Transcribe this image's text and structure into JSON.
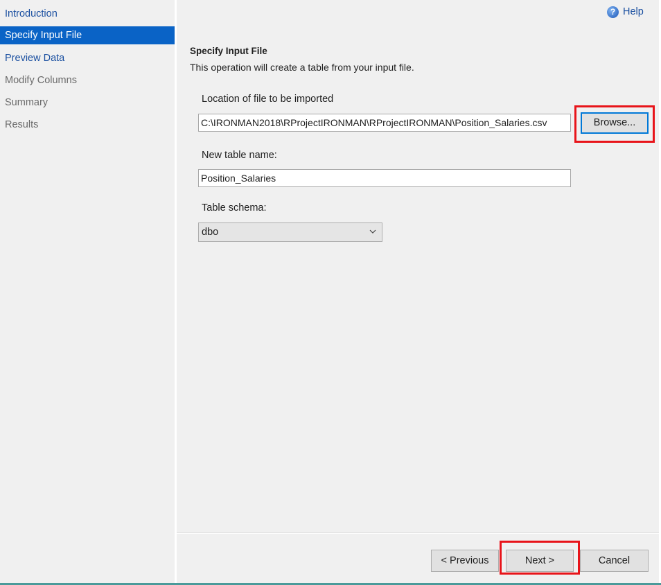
{
  "sidebar": {
    "items": [
      {
        "label": "Introduction",
        "state": "link"
      },
      {
        "label": "Specify Input File",
        "state": "active"
      },
      {
        "label": "Preview Data",
        "state": "link"
      },
      {
        "label": "Modify Columns",
        "state": "disabled"
      },
      {
        "label": "Summary",
        "state": "disabled"
      },
      {
        "label": "Results",
        "state": "disabled"
      }
    ]
  },
  "header": {
    "help_label": "Help",
    "help_icon": "help-circle-icon"
  },
  "main": {
    "title": "Specify Input File",
    "description": "This operation will create a table from your input file.",
    "file_location": {
      "label": "Location of file to be imported",
      "value": "C:\\IRONMAN2018\\RProjectIRONMAN\\RProjectIRONMAN\\Position_Salaries.csv",
      "browse_label": "Browse..."
    },
    "table_name": {
      "label": "New table name:",
      "value": "Position_Salaries"
    },
    "table_schema": {
      "label": "Table schema:",
      "selected": "dbo"
    }
  },
  "footer": {
    "previous_label": "< Previous",
    "next_label": "Next >",
    "cancel_label": "Cancel"
  },
  "colors": {
    "active_nav_bg": "#0a63c6",
    "link_text": "#1a4fa0",
    "highlight_box": "#e8141a"
  }
}
